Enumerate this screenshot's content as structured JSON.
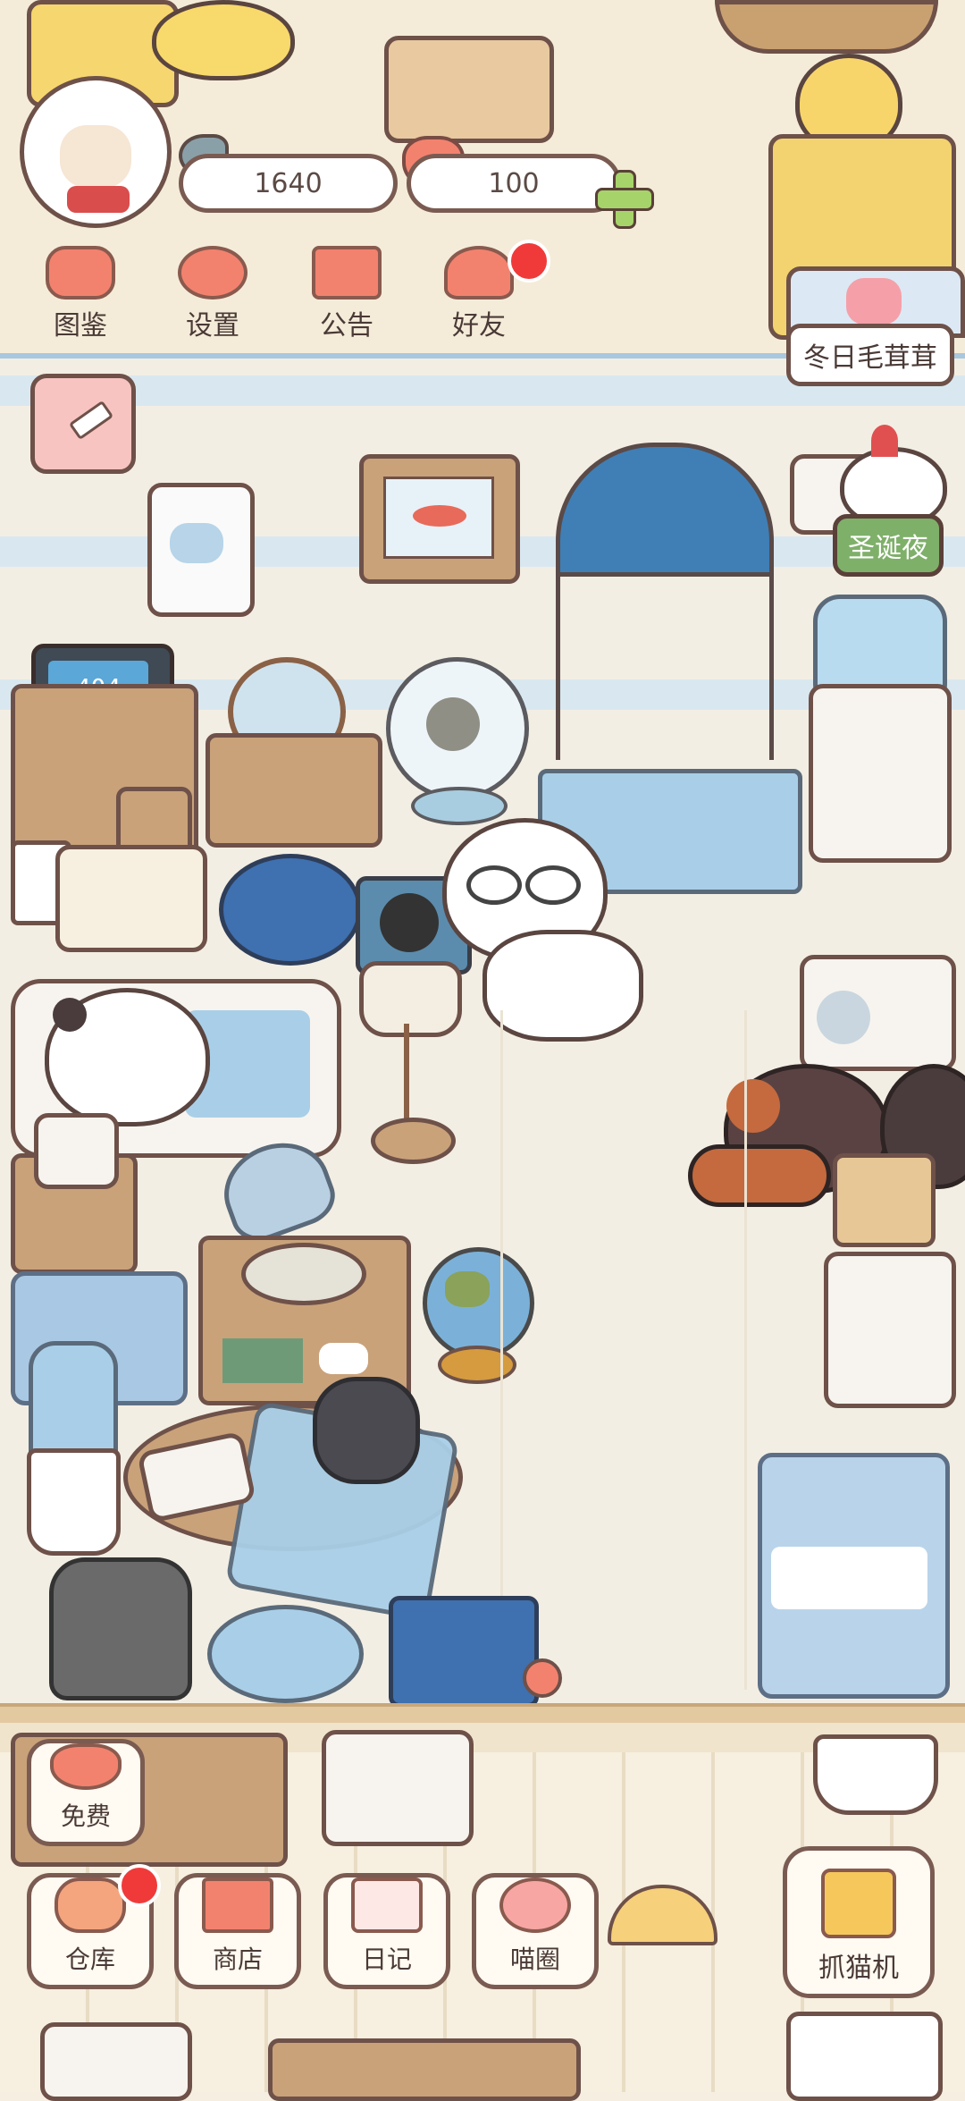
{
  "currency": {
    "fish": "1640",
    "hearts": "100",
    "add_icon": "plus-icon"
  },
  "top_menu": [
    {
      "label": "图鉴",
      "icon": "cat-book-icon"
    },
    {
      "label": "设置",
      "icon": "gear-icon"
    },
    {
      "label": "公告",
      "icon": "gift-icon"
    },
    {
      "label": "好友",
      "icon": "friends-icon"
    }
  ],
  "events": {
    "winter": "冬日毛茸茸",
    "christmas": "圣诞夜"
  },
  "screen_text": {
    "computer": "404"
  },
  "bottom_menu": {
    "free": "免费",
    "warehouse": "仓库",
    "shop": "商店",
    "diary": "日记",
    "circle": "喵圈",
    "claw": "抓猫机"
  },
  "colors": {
    "accent": "#f2826e",
    "badge": "#f03a3a",
    "event_green": "#7fb06a"
  }
}
